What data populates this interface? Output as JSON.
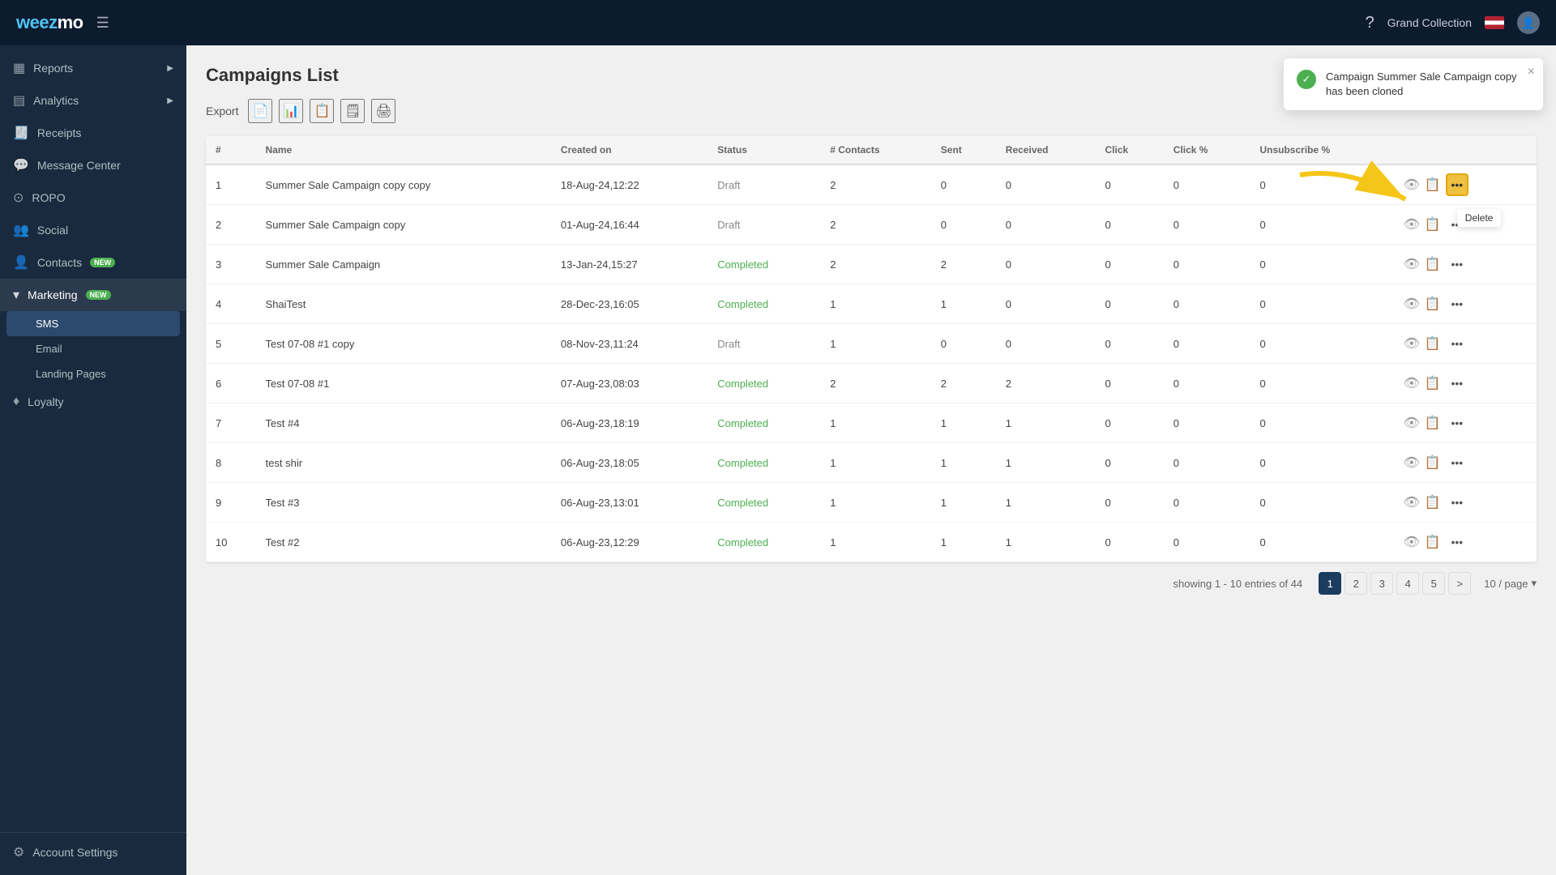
{
  "app": {
    "name": "weezmo",
    "org": "Grand Collection"
  },
  "topnav": {
    "hamburger": "☰",
    "help_label": "?",
    "org_name": "Grand Collection"
  },
  "sidebar": {
    "items": [
      {
        "id": "reports",
        "label": "Reports",
        "icon": "▦",
        "has_chevron": true
      },
      {
        "id": "analytics",
        "label": "Analytics",
        "icon": "▤",
        "has_chevron": true
      },
      {
        "id": "receipts",
        "label": "Receipts",
        "icon": "▤"
      },
      {
        "id": "message-center",
        "label": "Message Center",
        "icon": "◫"
      },
      {
        "id": "ropo",
        "label": "ROPO",
        "icon": "◎"
      },
      {
        "id": "social",
        "label": "Social",
        "icon": "◫"
      },
      {
        "id": "contacts",
        "label": "Contacts",
        "icon": "◫",
        "badge": "NEW"
      },
      {
        "id": "marketing",
        "label": "Marketing",
        "icon": "◈",
        "badge": "NEW",
        "expanded": true
      },
      {
        "id": "loyalty",
        "label": "Loyalty",
        "icon": "◈"
      },
      {
        "id": "account-settings",
        "label": "Account Settings",
        "icon": "⚙"
      }
    ],
    "sub_items": [
      {
        "id": "sms",
        "label": "SMS",
        "active": true
      },
      {
        "id": "email",
        "label": "Email"
      },
      {
        "id": "landing-pages",
        "label": "Landing Pages"
      }
    ]
  },
  "page": {
    "title": "Campaigns List"
  },
  "export": {
    "label": "Export",
    "buttons": [
      "📄",
      "📊",
      "📋",
      "🗒",
      "🖨"
    ]
  },
  "table": {
    "columns": [
      "#",
      "Name",
      "Created on",
      "Status",
      "# Contacts",
      "Sent",
      "Received",
      "Click",
      "Click %",
      "Unsubscribe %"
    ],
    "rows": [
      {
        "num": 1,
        "name": "Summer Sale Campaign copy copy",
        "created": "18-Aug-24,12:22",
        "status": "Draft",
        "contacts": 2,
        "sent": 0,
        "received": 0,
        "click": 0,
        "click_pct": 0,
        "unsub_pct": 0
      },
      {
        "num": 2,
        "name": "Summer Sale Campaign copy",
        "created": "01-Aug-24,16:44",
        "status": "Draft",
        "contacts": 2,
        "sent": 0,
        "received": 0,
        "click": 0,
        "click_pct": 0,
        "unsub_pct": 0
      },
      {
        "num": 3,
        "name": "Summer Sale Campaign",
        "created": "13-Jan-24,15:27",
        "status": "Completed",
        "contacts": 2,
        "sent": 2,
        "received": 0,
        "click": 0,
        "click_pct": 0,
        "unsub_pct": 0
      },
      {
        "num": 4,
        "name": "ShaiTest",
        "created": "28-Dec-23,16:05",
        "status": "Completed",
        "contacts": 1,
        "sent": 1,
        "received": 0,
        "click": 0,
        "click_pct": 0,
        "unsub_pct": 0
      },
      {
        "num": 5,
        "name": "Test 07-08 #1 copy",
        "created": "08-Nov-23,11:24",
        "status": "Draft",
        "contacts": 1,
        "sent": 0,
        "received": 0,
        "click": 0,
        "click_pct": 0,
        "unsub_pct": 0
      },
      {
        "num": 6,
        "name": "Test 07-08 #1",
        "created": "07-Aug-23,08:03",
        "status": "Completed",
        "contacts": 2,
        "sent": 2,
        "received": 2,
        "click": 0,
        "click_pct": 0,
        "unsub_pct": 0
      },
      {
        "num": 7,
        "name": "Test #4",
        "created": "06-Aug-23,18:19",
        "status": "Completed",
        "contacts": 1,
        "sent": 1,
        "received": 1,
        "click": 0,
        "click_pct": 0,
        "unsub_pct": 0
      },
      {
        "num": 8,
        "name": "test shir",
        "created": "06-Aug-23,18:05",
        "status": "Completed",
        "contacts": 1,
        "sent": 1,
        "received": 1,
        "click": 0,
        "click_pct": 0,
        "unsub_pct": 0
      },
      {
        "num": 9,
        "name": "Test #3",
        "created": "06-Aug-23,13:01",
        "status": "Completed",
        "contacts": 1,
        "sent": 1,
        "received": 1,
        "click": 0,
        "click_pct": 0,
        "unsub_pct": 0
      },
      {
        "num": 10,
        "name": "Test #2",
        "created": "06-Aug-23,12:29",
        "status": "Completed",
        "contacts": 1,
        "sent": 1,
        "received": 1,
        "click": 0,
        "click_pct": 0,
        "unsub_pct": 0
      }
    ]
  },
  "pagination": {
    "info": "showing 1 - 10 entries of 44",
    "pages": [
      1,
      2,
      3,
      4,
      5
    ],
    "active_page": 1,
    "next_label": ">",
    "per_page": "10 / page"
  },
  "toast": {
    "message": "Campaign Summer Sale Campaign copy has been cloned",
    "close_label": "×"
  },
  "dropdown": {
    "delete_label": "Delete"
  }
}
